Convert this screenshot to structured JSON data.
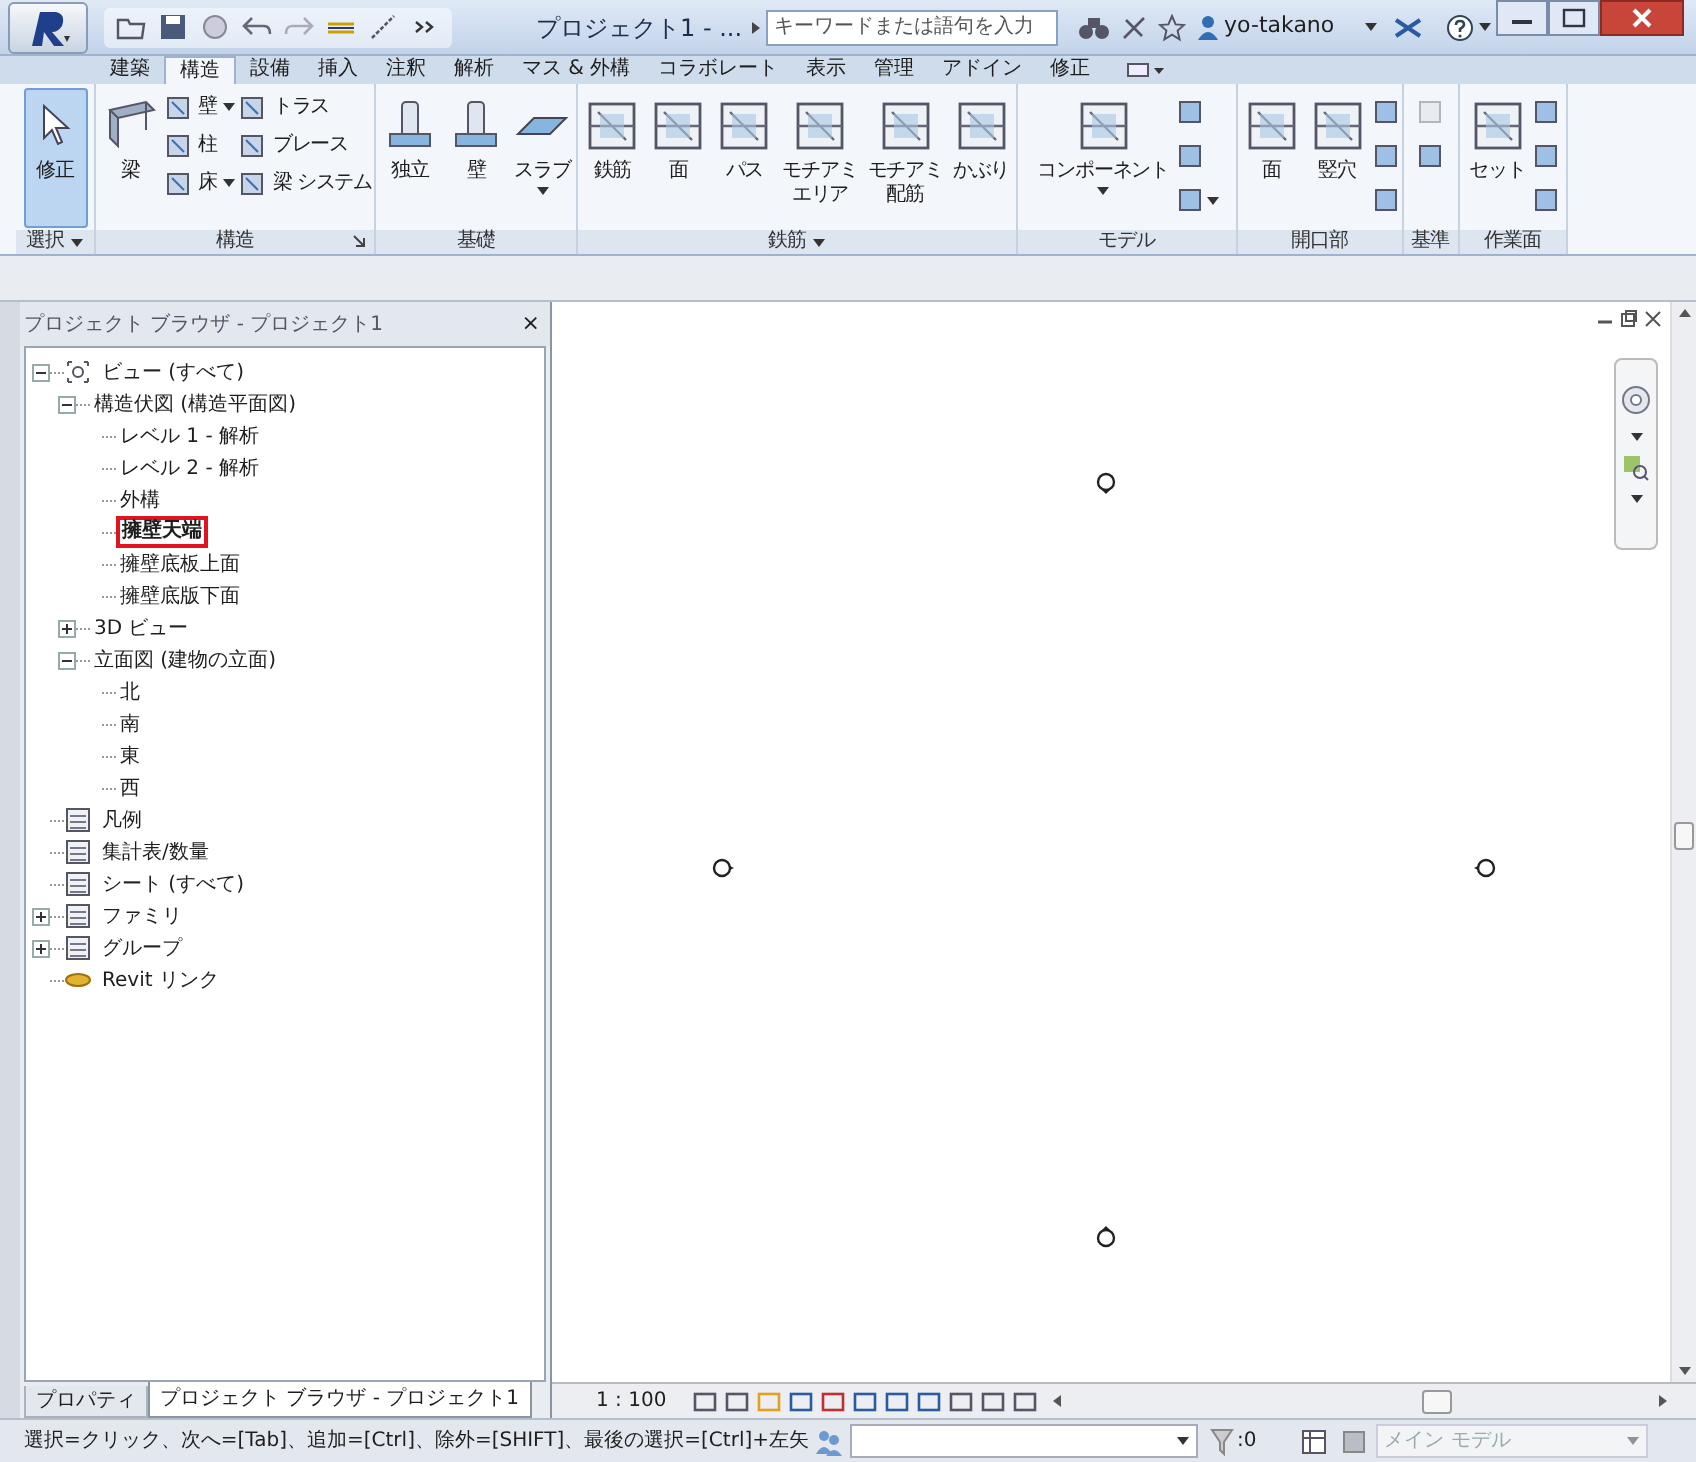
{
  "title_bar": {
    "title": "プロジェクト1 - ...",
    "search_placeholder": "キーワードまたは語句を入力",
    "user": "yo-takano"
  },
  "ribbon": {
    "tabs": [
      {
        "label": "建築",
        "selected": false
      },
      {
        "label": "構造",
        "selected": true
      },
      {
        "label": "設備",
        "selected": false
      },
      {
        "label": "挿入",
        "selected": false
      },
      {
        "label": "注釈",
        "selected": false
      },
      {
        "label": "解析",
        "selected": false
      },
      {
        "label": "マス & 外構",
        "selected": false
      },
      {
        "label": "コラボレート",
        "selected": false
      },
      {
        "label": "表示",
        "selected": false
      },
      {
        "label": "管理",
        "selected": false
      },
      {
        "label": "アドイン",
        "selected": false
      },
      {
        "label": "修正",
        "selected": false
      }
    ],
    "panels": [
      {
        "label": "選択",
        "menu": true,
        "buttons": [
          {
            "kind": "large",
            "label": "修正",
            "selected": true
          }
        ]
      },
      {
        "label": "構造",
        "launcher": true,
        "buttons": [
          {
            "kind": "large",
            "label": "梁",
            "selected": false
          },
          {
            "kind": "small",
            "label": "壁",
            "menu": true,
            "selected": false
          },
          {
            "kind": "small",
            "label": "柱",
            "selected": false
          },
          {
            "kind": "small",
            "label": "床",
            "menu": true,
            "selected": false
          },
          {
            "kind": "small",
            "label": "トラス",
            "selected": false
          },
          {
            "kind": "small",
            "label": "ブレース",
            "selected": false
          },
          {
            "kind": "small",
            "label": "梁 システム",
            "selected": false
          }
        ]
      },
      {
        "label": "基礎",
        "buttons": [
          {
            "kind": "large",
            "label": "独立",
            "selected": false
          },
          {
            "kind": "large",
            "label": "壁",
            "selected": false
          },
          {
            "kind": "large",
            "label": "スラブ",
            "menu": true,
            "selected": false
          }
        ]
      },
      {
        "label": "鉄筋",
        "menu": true,
        "buttons": [
          {
            "kind": "large",
            "label": "鉄筋",
            "selected": false
          },
          {
            "kind": "large",
            "label": "面",
            "selected": false
          },
          {
            "kind": "large",
            "label": "パス",
            "selected": false
          },
          {
            "kind": "large",
            "lines": [
              "モチアミ",
              "エリア"
            ],
            "selected": false
          },
          {
            "kind": "large",
            "lines": [
              "モチアミ",
              "配筋"
            ],
            "selected": false
          },
          {
            "kind": "large",
            "label": "かぶり",
            "selected": false
          }
        ]
      },
      {
        "label": "モデル",
        "buttons": [
          {
            "kind": "large",
            "label": "コンポーネント",
            "menu": true,
            "selected": false
          },
          {
            "kind": "icon",
            "selected": false
          },
          {
            "kind": "icon",
            "selected": false
          },
          {
            "kind": "icon",
            "menu": true,
            "selected": false
          }
        ]
      },
      {
        "label": "開口部",
        "buttons": [
          {
            "kind": "large",
            "label": "面",
            "selected": false
          },
          {
            "kind": "large",
            "label": "竪穴",
            "selected": false
          },
          {
            "kind": "icon",
            "selected": false
          },
          {
            "kind": "icon",
            "selected": false
          },
          {
            "kind": "icon",
            "selected": false
          }
        ]
      },
      {
        "label": "基準",
        "buttons": [
          {
            "kind": "icon",
            "disabled": true,
            "selected": false
          },
          {
            "kind": "icon",
            "selected": false
          }
        ]
      },
      {
        "label": "作業面",
        "buttons": [
          {
            "kind": "large",
            "label": "セット",
            "selected": false
          },
          {
            "kind": "icon",
            "selected": false
          },
          {
            "kind": "icon",
            "selected": false
          },
          {
            "kind": "icon",
            "selected": false
          }
        ]
      }
    ]
  },
  "project_browser": {
    "title": "プロジェクト ブラウザ - プロジェクト1",
    "close": "×",
    "tree": [
      {
        "label": "ビュー (すべて)",
        "expanded": true,
        "selected": false,
        "children": [
          {
            "label": "構造伏図 (構造平面図)",
            "expanded": true,
            "selected": false,
            "children": [
              {
                "label": "レベル 1 - 解析",
                "selected": false
              },
              {
                "label": "レベル 2 - 解析",
                "selected": false
              },
              {
                "label": "外構",
                "selected": false
              },
              {
                "label": "擁壁天端",
                "selected": true
              },
              {
                "label": "擁壁底板上面",
                "selected": false
              },
              {
                "label": "擁壁底版下面",
                "selected": false
              }
            ]
          },
          {
            "label": "3D ビュー",
            "expanded": false,
            "selected": false
          },
          {
            "label": "立面図 (建物の立面)",
            "expanded": true,
            "selected": false,
            "children": [
              {
                "label": "北",
                "selected": false
              },
              {
                "label": "南",
                "selected": false
              },
              {
                "label": "東",
                "selected": false
              },
              {
                "label": "西",
                "selected": false
              }
            ]
          }
        ]
      },
      {
        "label": "凡例",
        "selected": false
      },
      {
        "label": "集計表/数量",
        "selected": false
      },
      {
        "label": "シート (すべて)",
        "selected": false
      },
      {
        "label": "ファミリ",
        "expanded": false,
        "selected": false
      },
      {
        "label": "グループ",
        "expanded": false,
        "selected": false
      },
      {
        "label": "Revit リンク",
        "selected": false
      }
    ]
  },
  "panel_tabs": [
    {
      "label": "プロパティ",
      "selected": false
    },
    {
      "label": "プロジェクト ブラウザ - プロジェクト1",
      "selected": true
    }
  ],
  "view": {
    "scale": "1 : 100"
  },
  "status_bar": {
    "message": "選択=クリック、次へ=[Tab]、追加=[Ctrl]、除外=[SHIFT]、最後の選択=[Ctrl]+左矢",
    "filter_count": ":0",
    "model_placeholder": "メイン モデル"
  }
}
